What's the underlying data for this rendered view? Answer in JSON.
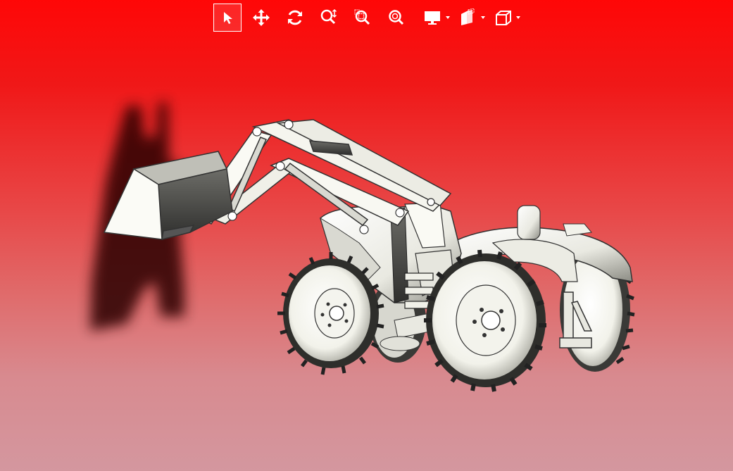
{
  "toolbar": {
    "buttons": [
      {
        "id": "select",
        "icon": "select-arrow-icon",
        "active": true
      },
      {
        "id": "pan",
        "icon": "pan-move-icon",
        "active": false
      },
      {
        "id": "rotate",
        "icon": "rotate-icon",
        "active": false
      },
      {
        "id": "zoom",
        "icon": "zoom-icon",
        "active": false
      },
      {
        "id": "zoom-window",
        "icon": "zoom-window-icon",
        "active": false
      },
      {
        "id": "zoom-fit",
        "icon": "zoom-fit-icon",
        "active": false
      },
      {
        "id": "display-mode",
        "icon": "monitor-icon",
        "active": false,
        "dropdown": true
      },
      {
        "id": "section",
        "icon": "section-plane-icon",
        "active": false,
        "dropdown": true
      },
      {
        "id": "view-cube",
        "icon": "view-cube-icon",
        "active": false,
        "dropdown": true
      }
    ]
  },
  "scene": {
    "model": "tractor-with-front-loader",
    "colors": {
      "background_top": "#ff0707",
      "background_bottom": "#d4979f",
      "model_fill": "#f7f7f2",
      "shadow": "#2a0606"
    }
  }
}
